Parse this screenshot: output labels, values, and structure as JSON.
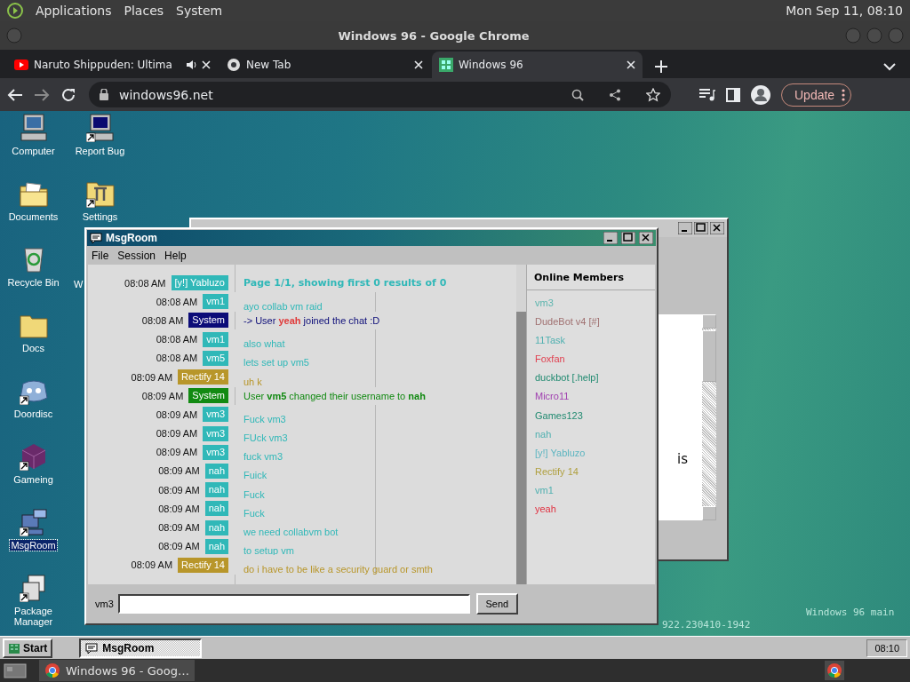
{
  "top_panel": {
    "menus": [
      "Applications",
      "Places",
      "System"
    ],
    "clock": "Mon Sep 11, 08:10"
  },
  "browser": {
    "title": "Windows 96 - Google Chrome",
    "tabs": [
      {
        "title": "Naruto Shippuden: Ultima",
        "kind": "video",
        "audio": true,
        "selected": false
      },
      {
        "title": "New Tab",
        "kind": "globe",
        "audio": false,
        "selected": false
      },
      {
        "title": "Windows 96",
        "kind": "grid",
        "audio": false,
        "selected": true
      }
    ],
    "url": "windows96.net",
    "update_label": "Update"
  },
  "desktop": {
    "icons": [
      {
        "label": "Computer",
        "kind": "computer",
        "shortcut": false,
        "selected": false
      },
      {
        "label": "Documents",
        "kind": "docfolder",
        "shortcut": false,
        "selected": false
      },
      {
        "label": "Recycle Bin",
        "kind": "recycle",
        "shortcut": false,
        "selected": false
      },
      {
        "label": "Docs",
        "kind": "folder",
        "shortcut": false,
        "selected": false
      },
      {
        "label": "Doordisc",
        "kind": "blob",
        "shortcut": true,
        "selected": false
      },
      {
        "label": "Gameing",
        "kind": "cube",
        "shortcut": true,
        "selected": false
      },
      {
        "label": "MsgRoom",
        "kind": "chatpc",
        "shortcut": true,
        "selected": true
      },
      {
        "label": "Package Manager",
        "kind": "boxes",
        "shortcut": true,
        "selected": false
      },
      {
        "label": "Report Bug",
        "kind": "monitor",
        "shortcut": true,
        "selected": false
      },
      {
        "label": "Settings",
        "kind": "tools",
        "shortcut": true,
        "selected": false
      },
      {
        "label": "W",
        "kind": "hidden",
        "selected": false
      }
    ],
    "version_lines": [
      "Windows 96 main",
      "922.230410-1942"
    ]
  },
  "back_window": {
    "text": "is"
  },
  "msgroom": {
    "title": "MsgRoom",
    "menus": [
      "File",
      "Session",
      "Help"
    ],
    "messages": [
      {
        "time": "08:08 AM",
        "user": "[y!] Yabluzo",
        "color": "#30b8b8",
        "text": "Page 1/1, showing first 0 results of 0",
        "kind": "result"
      },
      {
        "time": "08:08 AM",
        "user": "vm1",
        "color": "#30b8b8",
        "text": "ayo collab vm raid",
        "kind": "chat"
      },
      {
        "time": "08:08 AM",
        "user": "System",
        "color": "#0c0c78",
        "text": "-> User **yeah** joined the chat :D",
        "kind": "join"
      },
      {
        "time": "08:08 AM",
        "user": "vm1",
        "color": "#30b8b8",
        "text": "also what",
        "kind": "chat"
      },
      {
        "time": "08:08 AM",
        "user": "vm5",
        "color": "#30b8b8",
        "text": "lets set up vm5",
        "kind": "chat"
      },
      {
        "time": "08:09 AM",
        "user": "Rectify 14",
        "color": "#b8962a",
        "text": "uh k",
        "kind": "chat"
      },
      {
        "time": "08:09 AM",
        "user": "System",
        "color": "#128a12",
        "text": "User **vm5** changed their username to **nah**",
        "kind": "rename"
      },
      {
        "time": "08:09 AM",
        "user": "vm3",
        "color": "#30b8b8",
        "text": "Fuck vm3",
        "kind": "chat"
      },
      {
        "time": "08:09 AM",
        "user": "vm3",
        "color": "#30b8b8",
        "text": "FUck vm3",
        "kind": "chat"
      },
      {
        "time": "08:09 AM",
        "user": "vm3",
        "color": "#30b8b8",
        "text": "fuck vm3",
        "kind": "chat"
      },
      {
        "time": "08:09 AM",
        "user": "nah",
        "color": "#30b8b8",
        "text": "Fuick",
        "kind": "chat"
      },
      {
        "time": "08:09 AM",
        "user": "nah",
        "color": "#30b8b8",
        "text": "Fuck",
        "kind": "chat"
      },
      {
        "time": "08:09 AM",
        "user": "nah",
        "color": "#30b8b8",
        "text": "Fuck",
        "kind": "chat"
      },
      {
        "time": "08:09 AM",
        "user": "nah",
        "color": "#30b8b8",
        "text": "we need collabvm bot",
        "kind": "chat"
      },
      {
        "time": "08:09 AM",
        "user": "nah",
        "color": "#30b8b8",
        "text": "to setup vm",
        "kind": "chat"
      },
      {
        "time": "08:09 AM",
        "user": "Rectify 14",
        "color": "#b8962a",
        "text": "do i have to be like a security guard or smth",
        "kind": "chat"
      }
    ],
    "members_title": "Online Members",
    "members": [
      {
        "name": "vm3",
        "color": "#5cb5ae"
      },
      {
        "name": "DudeBot v4 [#]",
        "color": "#a07070"
      },
      {
        "name": "11Task",
        "color": "#4fb0b0"
      },
      {
        "name": "Foxfan",
        "color": "#e04050"
      },
      {
        "name": "duckbot [.help]",
        "color": "#208a70"
      },
      {
        "name": "Micro11",
        "color": "#a040b0"
      },
      {
        "name": "Games123",
        "color": "#208a70"
      },
      {
        "name": "nah",
        "color": "#4fb0b0"
      },
      {
        "name": "[y!] Yabluzo",
        "color": "#5cb5c0"
      },
      {
        "name": "Rectify 14",
        "color": "#b0a040"
      },
      {
        "name": "vm1",
        "color": "#4fb0b0"
      },
      {
        "name": "yeah",
        "color": "#e03040"
      }
    ],
    "nickname": "vm3",
    "send_label": "Send"
  },
  "taskbar": {
    "start_label": "Start",
    "tasks": [
      {
        "label": "MsgRoom",
        "selected": true
      }
    ],
    "clock": "08:10"
  },
  "linux_panel": {
    "tasks": [
      {
        "label": "Windows 96 - Goog…"
      }
    ]
  }
}
